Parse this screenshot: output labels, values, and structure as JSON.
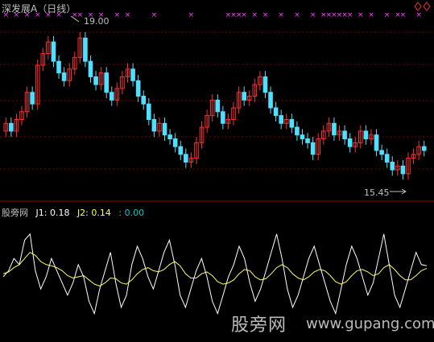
{
  "header": {
    "title": "深发展A（日线）"
  },
  "price_panel": {
    "high_label": "19.00",
    "low_label": "15.45",
    "colors": {
      "up": "#ff3030",
      "down": "#50e0ff",
      "signal": "#ff40ff",
      "grid": "#800000"
    }
  },
  "indicator_panel": {
    "name": "股旁网",
    "j1": "J1: 0.18",
    "j2": "J2: 0.14",
    "j3": ": 0.00",
    "colors": {
      "j1": "#ffffff",
      "j2": "#ffff66",
      "j3": "#00c8c8"
    }
  },
  "watermark": {
    "text": "股旁网",
    "url": "www.gupang.com"
  },
  "chart_data": [
    {
      "type": "candlestick",
      "title": "",
      "ylim": [
        15.0,
        19.4
      ],
      "annotations": [
        "19.00",
        "15.45"
      ],
      "closes": [
        16.8,
        16.6,
        16.9,
        17.1,
        17.6,
        17.3,
        18.3,
        18.6,
        18.9,
        18.4,
        18.1,
        17.9,
        18.2,
        18.5,
        19.0,
        18.4,
        18.0,
        17.8,
        18.1,
        17.6,
        17.4,
        17.7,
        18.0,
        18.2,
        17.9,
        17.5,
        17.3,
        16.9,
        16.6,
        16.8,
        16.5,
        16.4,
        16.2,
        16.0,
        15.8,
        15.9,
        16.3,
        16.7,
        17.0,
        17.4,
        17.1,
        16.8,
        16.9,
        17.2,
        17.6,
        17.4,
        17.5,
        17.8,
        18.0,
        17.6,
        17.2,
        17.0,
        16.8,
        16.9,
        16.7,
        16.5,
        16.4,
        16.3,
        16.0,
        16.4,
        16.6,
        16.8,
        16.5,
        16.6,
        16.4,
        16.2,
        16.3,
        16.6,
        16.4,
        16.5,
        16.1,
        16.0,
        15.8,
        15.6,
        15.7,
        15.5,
        15.9,
        16.0,
        16.2,
        16.1
      ],
      "opens": [
        16.6,
        16.8,
        16.6,
        16.9,
        17.1,
        17.6,
        17.3,
        18.3,
        18.6,
        18.9,
        18.4,
        18.1,
        17.9,
        18.2,
        18.5,
        19.0,
        18.4,
        18.0,
        17.8,
        18.1,
        17.6,
        17.4,
        17.7,
        18.0,
        18.2,
        17.9,
        17.5,
        17.3,
        16.9,
        16.6,
        16.8,
        16.5,
        16.4,
        16.2,
        16.0,
        15.8,
        15.9,
        16.3,
        16.7,
        17.0,
        17.4,
        17.1,
        16.8,
        16.9,
        17.2,
        17.6,
        17.4,
        17.5,
        17.8,
        18.0,
        17.6,
        17.2,
        17.0,
        16.8,
        16.9,
        16.7,
        16.5,
        16.4,
        16.3,
        16.0,
        16.4,
        16.6,
        16.8,
        16.5,
        16.6,
        16.4,
        16.2,
        16.3,
        16.6,
        16.4,
        16.5,
        16.1,
        16.0,
        15.8,
        15.6,
        15.7,
        15.5,
        15.9,
        16.0,
        16.2
      ]
    },
    {
      "type": "line",
      "title": "",
      "ylim": [
        -1.0,
        1.0
      ],
      "series": [
        {
          "name": "J1",
          "values": [
            0.0,
            0.1,
            0.3,
            0.2,
            0.6,
            0.7,
            0.1,
            -0.2,
            0.0,
            0.3,
            0.1,
            -0.1,
            -0.3,
            -0.1,
            0.2,
            0.0,
            -0.4,
            -0.6,
            -0.2,
            0.1,
            0.4,
            -0.1,
            -0.5,
            -0.3,
            0.2,
            0.5,
            0.3,
            0.0,
            -0.2,
            0.1,
            0.4,
            0.6,
            0.2,
            -0.3,
            -0.5,
            -0.2,
            0.1,
            0.3,
            0.0,
            -0.4,
            -0.6,
            -0.3,
            0.0,
            0.2,
            0.5,
            0.3,
            -0.1,
            -0.4,
            -0.2,
            0.1,
            0.4,
            0.7,
            0.3,
            -0.2,
            -0.5,
            -0.3,
            0.0,
            0.3,
            0.5,
            0.2,
            -0.1,
            -0.4,
            -0.6,
            -0.2,
            0.2,
            0.5,
            0.3,
            0.0,
            -0.3,
            -0.1,
            0.3,
            0.7,
            0.2,
            -0.3,
            -0.5,
            -0.2,
            0.1,
            0.4,
            0.2,
            0.18
          ]
        },
        {
          "name": "J2",
          "values": [
            0.05,
            0.08,
            0.15,
            0.2,
            0.3,
            0.4,
            0.35,
            0.25,
            0.2,
            0.18,
            0.15,
            0.1,
            0.02,
            -0.02,
            0.0,
            0.02,
            -0.05,
            -0.12,
            -0.15,
            -0.1,
            -0.02,
            -0.03,
            -0.1,
            -0.12,
            -0.05,
            0.05,
            0.12,
            0.15,
            0.1,
            0.08,
            0.12,
            0.2,
            0.25,
            0.18,
            0.05,
            -0.02,
            -0.02,
            0.05,
            0.08,
            0.02,
            -0.08,
            -0.12,
            -0.1,
            -0.05,
            0.05,
            0.12,
            0.1,
            0.0,
            -0.05,
            -0.03,
            0.05,
            0.15,
            0.2,
            0.15,
            0.05,
            -0.02,
            -0.05,
            0.0,
            0.08,
            0.12,
            0.1,
            0.02,
            -0.08,
            -0.12,
            -0.08,
            0.02,
            0.1,
            0.12,
            0.08,
            0.02,
            0.05,
            0.15,
            0.2,
            0.12,
            0.02,
            -0.05,
            -0.05,
            0.02,
            0.1,
            0.14
          ]
        }
      ]
    }
  ]
}
